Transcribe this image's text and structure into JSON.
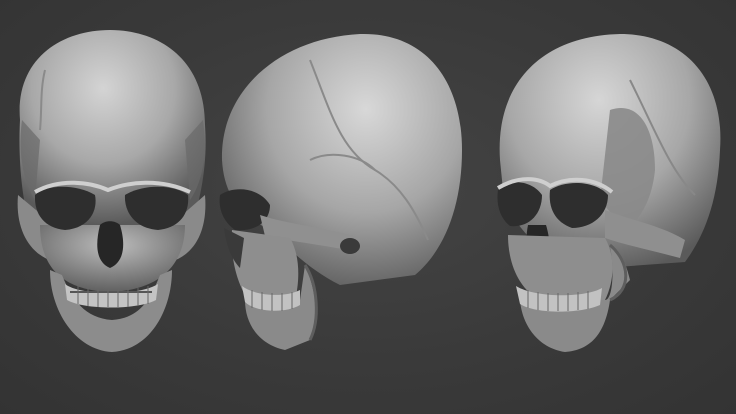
{
  "scene": {
    "background_color": "#3a3a3a",
    "material_color": "#9a9a9a",
    "views": [
      {
        "id": "front",
        "icon": "skull-front-view"
      },
      {
        "id": "side",
        "icon": "skull-side-view"
      },
      {
        "id": "three_quarter",
        "icon": "skull-three-quarter-view"
      }
    ]
  }
}
